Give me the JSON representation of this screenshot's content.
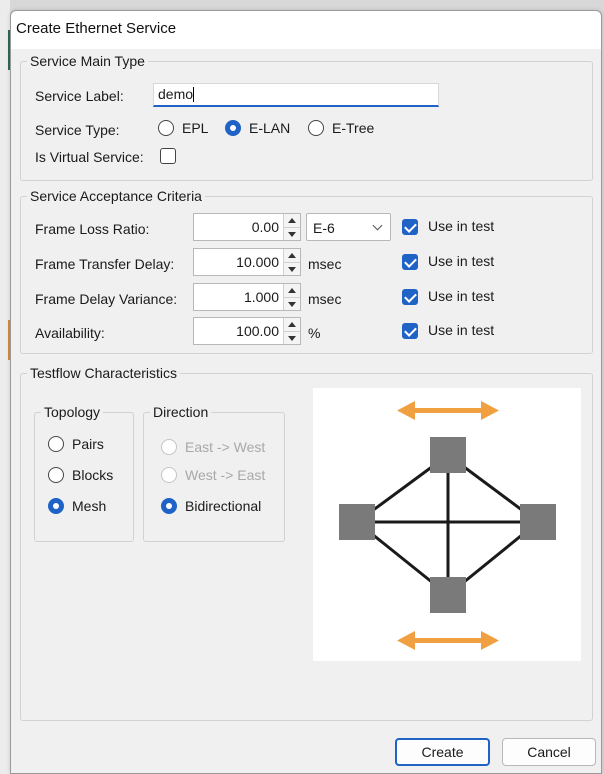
{
  "dialog": {
    "title": "Create Ethernet Service"
  },
  "main_type": {
    "legend": "Service Main Type",
    "label_label": "Service Label:",
    "label_value": "demo",
    "type_label": "Service Type:",
    "type_options": [
      "EPL",
      "E-LAN",
      "E-Tree"
    ],
    "type_selected": "E-LAN",
    "virtual_label": "Is Virtual Service:",
    "virtual_checked": false
  },
  "acceptance": {
    "legend": "Service Acceptance Criteria",
    "use_in_test_label": "Use in test",
    "rows": [
      {
        "label": "Frame Loss Ratio:",
        "value": "0.00",
        "unit": "E-6",
        "unit_is_select": true,
        "use_in_test": true
      },
      {
        "label": "Frame Transfer Delay:",
        "value": "10.000",
        "unit": "msec",
        "unit_is_select": false,
        "use_in_test": true
      },
      {
        "label": "Frame Delay Variance:",
        "value": "1.000",
        "unit": "msec",
        "unit_is_select": false,
        "use_in_test": true
      },
      {
        "label": "Availability:",
        "value": "100.00",
        "unit": "%",
        "unit_is_select": false,
        "use_in_test": true
      }
    ]
  },
  "testflow": {
    "legend": "Testflow Characteristics",
    "topology": {
      "legend": "Topology",
      "options": [
        "Pairs",
        "Blocks",
        "Mesh"
      ],
      "selected": "Mesh"
    },
    "direction": {
      "legend": "Direction",
      "options": [
        "East -> West",
        "West -> East",
        "Bidirectional"
      ],
      "selected": "Bidirectional",
      "disabled": [
        "East -> West",
        "West -> East"
      ]
    },
    "diagram_colors": {
      "node": "#7a7a7a",
      "line": "#1a1a1a",
      "arrow": "#f0a040"
    }
  },
  "buttons": {
    "create": "Create",
    "cancel": "Cancel"
  },
  "colors": {
    "accent": "#1f63c6",
    "dialog_bg": "#f0f0f0"
  }
}
